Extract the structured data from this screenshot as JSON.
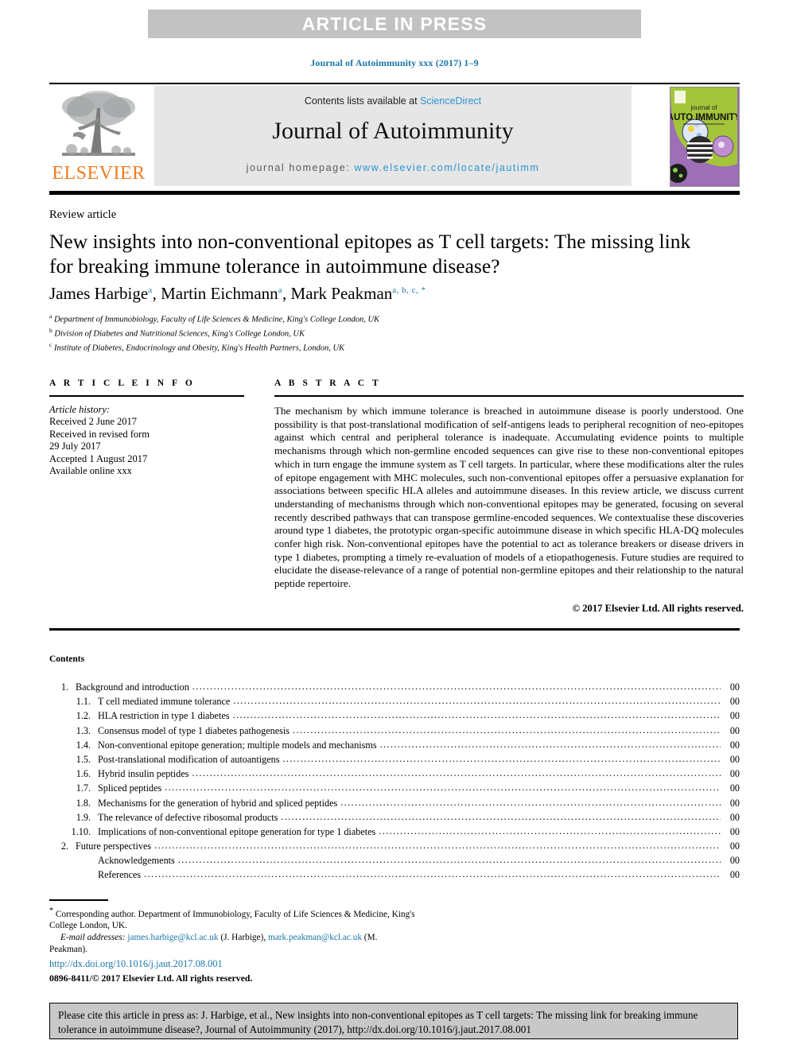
{
  "banner": {
    "text": "ARTICLE IN PRESS"
  },
  "journal_citation": "Journal of Autoimmunity xxx (2017) 1–9",
  "masthead": {
    "contents_prefix": "Contents lists available at ",
    "sciencedirect": "ScienceDirect",
    "journal_title": "Journal of Autoimmunity",
    "homepage_prefix": "journal homepage: ",
    "homepage_url": "www.elsevier.com/locate/jautimm",
    "publisher_wordmark": "ELSEVIER",
    "cover": {
      "line_small": "journal of",
      "line_big": "AUTO IMMUNITY"
    }
  },
  "article": {
    "type": "Review article",
    "title": "New insights into non-conventional epitopes as T cell targets: The missing link for breaking immune tolerance in autoimmune disease?",
    "authors": [
      {
        "name": "James Harbige",
        "sup": "a"
      },
      {
        "name": "Martin Eichmann",
        "sup": "a"
      },
      {
        "name": "Mark Peakman",
        "sup": "a, b, c, *"
      }
    ],
    "affiliations": [
      {
        "marker": "a",
        "text": "Department of Immunobiology, Faculty of Life Sciences & Medicine, King's College London, UK"
      },
      {
        "marker": "b",
        "text": "Division of Diabetes and Nutritional Sciences, King's College London, UK"
      },
      {
        "marker": "c",
        "text": "Institute of Diabetes, Endocrinology and Obesity, King's Health Partners, London, UK"
      }
    ]
  },
  "info": {
    "heading": "A R T I C L E  I N F O",
    "history_label": "Article history:",
    "history": [
      "Received 2 June 2017",
      "Received in revised form",
      "29 July 2017",
      "Accepted 1 August 2017",
      "Available online xxx"
    ]
  },
  "abstract": {
    "heading": "A B S T R A C T",
    "body": "The mechanism by which immune tolerance is breached in autoimmune disease is poorly understood. One possibility is that post-translational modification of self-antigens leads to peripheral recognition of neo-epitopes against which central and peripheral tolerance is inadequate. Accumulating evidence points to multiple mechanisms through which non-germline encoded sequences can give rise to these non-conventional epitopes which in turn engage the immune system as T cell targets. In particular, where these modifications alter the rules of epitope engagement with MHC molecules, such non-conventional epitopes offer a persuasive explanation for associations between specific HLA alleles and autoimmune diseases. In this review article, we discuss current understanding of mechanisms through which non-conventional epitopes may be generated, focusing on several recently described pathways that can transpose germline-encoded sequences. We contextualise these discoveries around type 1 diabetes, the prototypic organ-specific autoimmune disease in which specific HLA-DQ molecules confer high risk. Non-conventional epitopes have the potential to act as tolerance breakers or disease drivers in type 1 diabetes, prompting a timely re-evaluation of models of a etiopathogenesis. Future studies are required to elucidate the disease-relevance of a range of potential non-germline epitopes and their relationship to the natural peptide repertoire.",
    "copyright": "© 2017 Elsevier Ltd. All rights reserved."
  },
  "contents": {
    "heading": "Contents",
    "entries": [
      {
        "level": 1,
        "num": "1.",
        "label": "Background and introduction",
        "page": "00"
      },
      {
        "level": 2,
        "num": "1.1.",
        "label": "T cell mediated immune tolerance",
        "page": "00"
      },
      {
        "level": 2,
        "num": "1.2.",
        "label": "HLA restriction in type 1 diabetes",
        "page": "00"
      },
      {
        "level": 2,
        "num": "1.3.",
        "label": "Consensus model of type 1 diabetes pathogenesis",
        "page": "00"
      },
      {
        "level": 2,
        "num": "1.4.",
        "label": "Non-conventional epitope generation; multiple models and mechanisms",
        "page": "00"
      },
      {
        "level": 2,
        "num": "1.5.",
        "label": "Post-translational modification of autoantigens",
        "page": "00"
      },
      {
        "level": 2,
        "num": "1.6.",
        "label": "Hybrid insulin peptides",
        "page": "00"
      },
      {
        "level": 2,
        "num": "1.7.",
        "label": "Spliced peptides",
        "page": "00"
      },
      {
        "level": 2,
        "num": "1.8.",
        "label": "Mechanisms for the generation of hybrid and spliced peptides",
        "page": "00"
      },
      {
        "level": 2,
        "num": "1.9.",
        "label": "The relevance of defective ribosomal products",
        "page": "00"
      },
      {
        "level": 2,
        "num": "1.10.",
        "label": "Implications of non-conventional epitope generation for type 1 diabetes",
        "page": "00"
      },
      {
        "level": 1,
        "num": "2.",
        "label": "Future perspectives",
        "page": "00"
      },
      {
        "level": 3,
        "num": "",
        "label": "Acknowledgements",
        "page": "00"
      },
      {
        "level": 3,
        "num": "",
        "label": "References",
        "page": "00"
      }
    ]
  },
  "footnotes": {
    "corresponding_marker": "*",
    "corresponding": " Corresponding author. Department of Immunobiology, Faculty of Life Sciences & Medicine, King's College London, UK.",
    "email_label": "E-mail addresses:",
    "email1": "james.harbige@kcl.ac.uk",
    "email1_owner": " (J. Harbige), ",
    "email2": "mark.peakman@kcl.ac.uk",
    "email2_owner": " (M. Peakman).",
    "doi": "http://dx.doi.org/10.1016/j.jaut.2017.08.001",
    "issn": "0896-8411/© 2017 Elsevier Ltd. All rights reserved."
  },
  "cite_box": {
    "text": "Please cite this article in press as: J. Harbige, et al., New insights into non-conventional epitopes as T cell targets: The missing link for breaking immune tolerance in autoimmune disease?, Journal of Autoimmunity (2017), http://dx.doi.org/10.1016/j.jaut.2017.08.001"
  },
  "colors": {
    "link": "#1a76a8",
    "sciencedirect": "#2a93d1",
    "elsevier_orange": "#ef7d22",
    "banner_gray": "#c2c2c2",
    "masthead_gray": "#e6e6e6",
    "cite_box_gray": "#c8c8c8"
  }
}
